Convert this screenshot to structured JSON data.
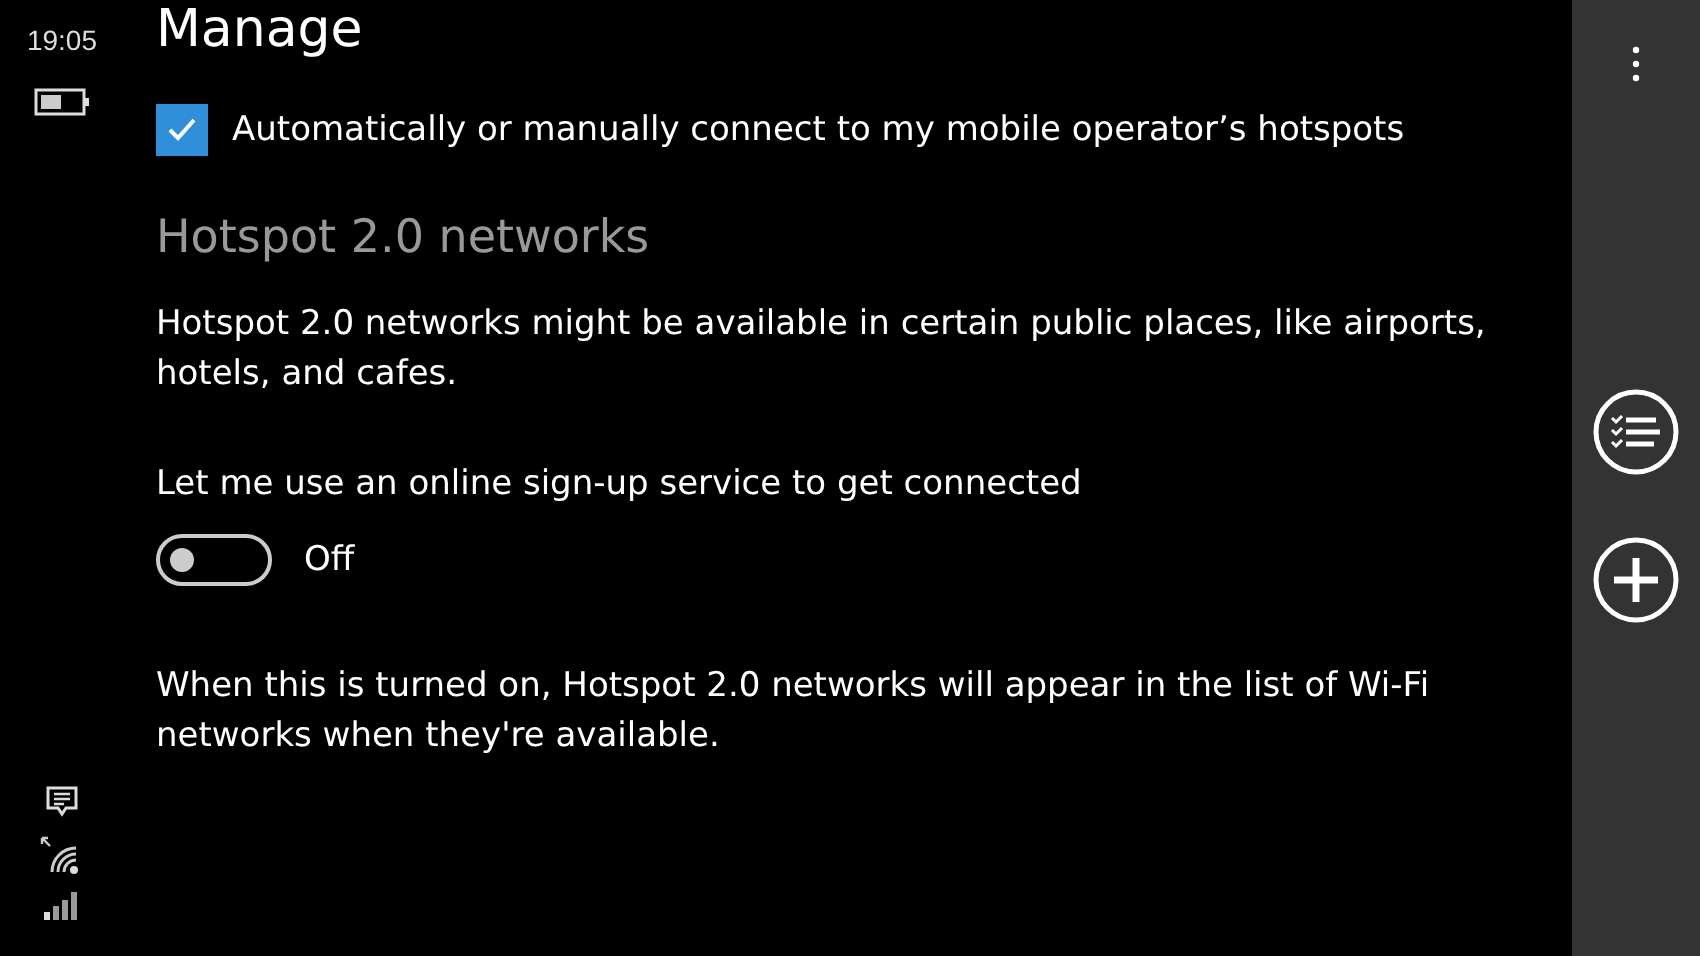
{
  "status_bar": {
    "time": "19:05"
  },
  "page": {
    "title": "Manage"
  },
  "operator_checkbox": {
    "label": "Automatically or manually connect to my mobile operator’s hotspots",
    "checked": true
  },
  "section": {
    "title": "Hotspot 2.0 networks",
    "description": "Hotspot 2.0 networks might be available in certain public places, like airports, hotels, and cafes."
  },
  "signup": {
    "label": "Let me use an online sign-up service to get connected",
    "on": false,
    "state_text": "Off"
  },
  "note": "When this is turned on, Hotspot 2.0 networks will appear in the list of Wi-Fi networks when they're available."
}
